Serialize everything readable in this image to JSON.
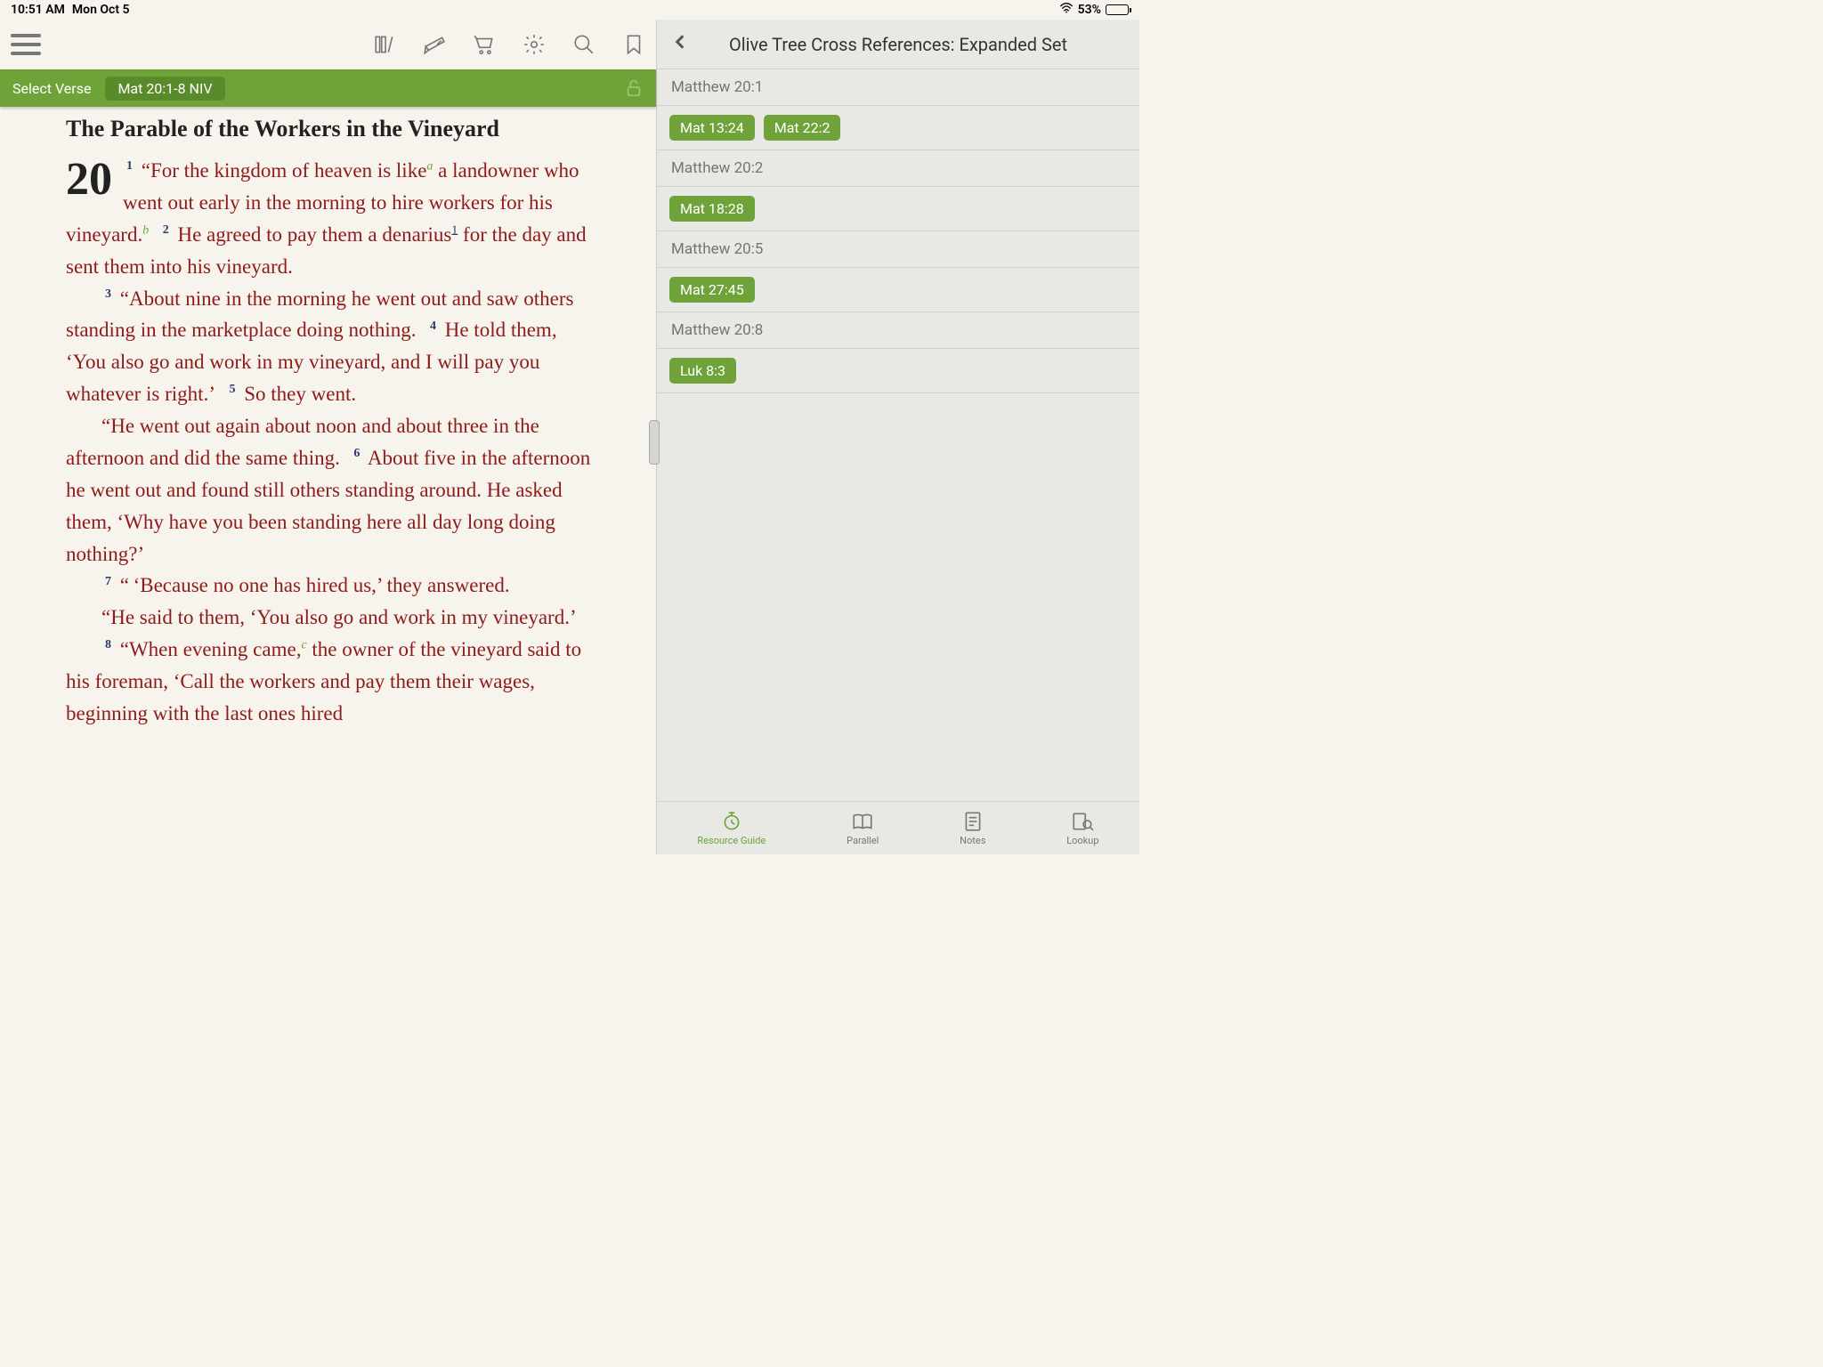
{
  "status": {
    "time": "10:51 AM",
    "date": "Mon Oct 5",
    "battery_pct": "53%"
  },
  "greenbar": {
    "select_verse": "Select Verse",
    "verse_ref": "Mat 20:1-8 NIV"
  },
  "passage": {
    "title": "The Parable of the Workers in the Vineyard",
    "chapter": "20",
    "v1_a": "“For the kingdom of heaven is like",
    "v1_b": " a landowner who went out early in the morning to hire workers for his vineyard.",
    "v2": "He agreed to pay them a denarius",
    "v2_b": " for the day and sent them into his vineyard.",
    "v3": "“About nine in the morning he went out and saw others standing in the marketplace doing noth­ing.",
    "v4": "He told them, ‘You also go and work in my vineyard, and I will pay you whatever is right.’",
    "v5": "So they went.",
    "v5_b": "“He went out again about noon and about three in the afternoon and did the same thing.",
    "v6": "About five in the afternoon he went out and found still others standing around. He asked them, ‘Why have you been standing here all day long doing nothing?’",
    "v7": "“ ‘Because no one has hired us,’ they answered.",
    "v7_b": "“He said to them, ‘You also go and work in my vineyard.’",
    "v8": "“When evening came,",
    "v8_b": " the owner of the vine­yard said to his foreman, ‘Call the workers and pay them their wages, beginning with the last ones hired"
  },
  "right": {
    "title": "Olive Tree Cross References: Expanded Set",
    "sections": [
      {
        "header": "Matthew 20:1",
        "tags": [
          "Mat 13:24",
          "Mat 22:2"
        ]
      },
      {
        "header": "Matthew 20:2",
        "tags": [
          "Mat 18:28"
        ]
      },
      {
        "header": "Matthew 20:5",
        "tags": [
          "Mat 27:45"
        ]
      },
      {
        "header": "Matthew 20:8",
        "tags": [
          "Luk 8:3"
        ]
      }
    ]
  },
  "tabs": {
    "resource": "Resource Guide",
    "parallel": "Parallel",
    "notes": "Notes",
    "lookup": "Lookup"
  }
}
